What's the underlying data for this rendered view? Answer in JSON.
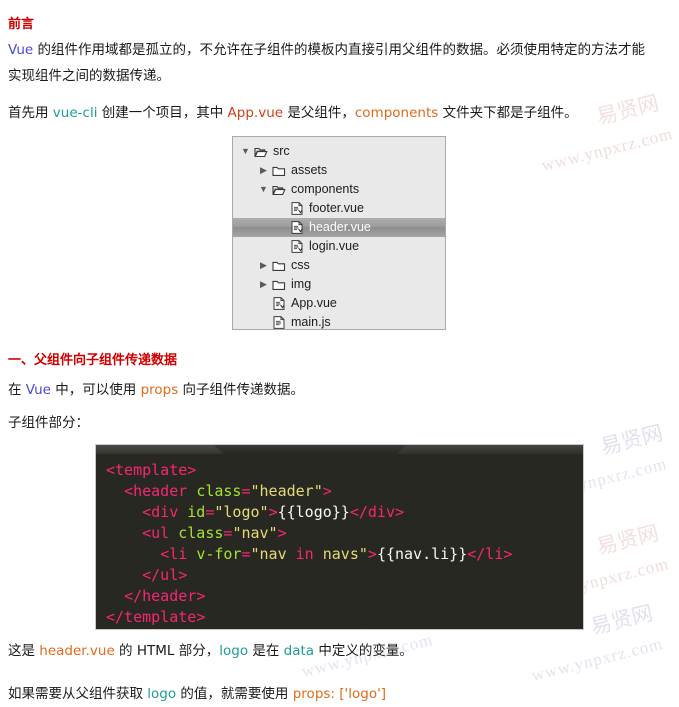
{
  "page": {
    "heading_1": "前言",
    "heading_2": "一、父组件向子组件传递数据"
  },
  "paragraphs": {
    "intro_line1_pre": "",
    "intro_kw": "Vue",
    "intro_line1_post": " 的组件作用域都是孤立的，不允许在子组件的模板内直接引用父组件的数据。必须使用特定的方法才能",
    "intro_line2": "实现组件之间的数据传递。",
    "setup_a": "首先用 ",
    "setup_kw1": "vue-cli",
    "setup_b": " 创建一个项目，其中 ",
    "setup_kw2": "App.vue",
    "setup_c": " 是父组件，",
    "setup_kw3": "components",
    "setup_d": " 文件夹下都是子组件。",
    "props_a": "在 ",
    "props_kw1": "Vue",
    "props_b": " 中，可以使用 ",
    "props_kw2": "props",
    "props_c": " 向子组件传递数据。",
    "child_part": "子组件部分：",
    "after_a": "这是 ",
    "after_kw1": "header.vue",
    "after_b": " 的 ",
    "after_kw2": "HTML",
    "after_c": " 部分，",
    "after_kw3": "logo",
    "after_d": " 是在 ",
    "after_kw4": "data",
    "after_e": " 中定义的变量。",
    "last_a": "如果需要从父组件获取 ",
    "last_kw1": "logo",
    "last_b": " 的值，就需要使用 ",
    "last_kw2": "props: ['logo']"
  },
  "filetree": {
    "rows": [
      {
        "indent": 0,
        "arrow": "▼",
        "icon": "folder-open-icon",
        "label": "src",
        "selected": false
      },
      {
        "indent": 1,
        "arrow": "▶",
        "icon": "folder-icon",
        "label": "assets",
        "selected": false
      },
      {
        "indent": 1,
        "arrow": "▼",
        "icon": "folder-open-icon",
        "label": "components",
        "selected": false
      },
      {
        "indent": 2,
        "arrow": "",
        "icon": "vue-file-icon",
        "label": "footer.vue",
        "selected": false
      },
      {
        "indent": 2,
        "arrow": "",
        "icon": "vue-file-icon",
        "label": "header.vue",
        "selected": true
      },
      {
        "indent": 2,
        "arrow": "",
        "icon": "vue-file-icon",
        "label": "login.vue",
        "selected": false
      },
      {
        "indent": 1,
        "arrow": "▶",
        "icon": "folder-icon",
        "label": "css",
        "selected": false
      },
      {
        "indent": 1,
        "arrow": "▶",
        "icon": "folder-icon",
        "label": "img",
        "selected": false
      },
      {
        "indent": 1,
        "arrow": "",
        "icon": "vue-file-icon",
        "label": "App.vue",
        "selected": false
      },
      {
        "indent": 1,
        "arrow": "",
        "icon": "js-file-icon",
        "label": "main.js",
        "selected": false
      }
    ]
  },
  "code": {
    "language": "html",
    "lines": [
      "<template>",
      "  <header class=\"header\">",
      "    <div id=\"logo\">{{logo}}</div>",
      "    <ul class=\"nav\">",
      "      <li v-for=\"nav in navs\">{{nav.li}}</li>",
      "    </ul>",
      "  </header>",
      "</template>"
    ]
  },
  "watermark": {
    "cn_text": "易贤网",
    "url_text": "www.ynpxrz.com"
  },
  "colors": {
    "heading": "#d00000",
    "kw_blue": "#4a4ad0",
    "kw_teal": "#1f9c96",
    "kw_orange": "#e06a1b",
    "code_bg": "#272822",
    "code_tag": "#f92672",
    "code_attr": "#a6e22e",
    "code_str": "#e6db74",
    "tree_bg": "#e9e9e9",
    "tree_selected": "#9b9b9b",
    "watermark": "#e8c9c4"
  }
}
